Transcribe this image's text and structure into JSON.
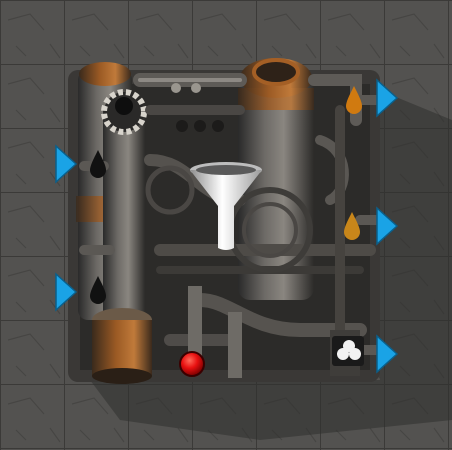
{
  "scene": {
    "entity": "oil-refinery",
    "ground": "concrete-tiles"
  },
  "recipe_icon": {
    "name": "filter-icon",
    "color": "#e8e8e8"
  },
  "ports": {
    "inputs": [
      {
        "name": "input-arrow-left-upper-icon",
        "fluid": "crude-oil",
        "color": "#1aa3e6"
      },
      {
        "name": "input-arrow-left-lower-icon",
        "fluid": "water",
        "color": "#1aa3e6"
      }
    ],
    "outputs": [
      {
        "name": "output-arrow-right-1-icon",
        "fluid": "petroleum-gas",
        "color": "#1aa3e6"
      },
      {
        "name": "output-arrow-right-2-icon",
        "fluid": "light-oil",
        "color": "#1aa3e6"
      },
      {
        "name": "output-arrow-right-3-icon",
        "fluid": "heavy-oil",
        "color": "#1aa3e6"
      }
    ]
  },
  "fluid_drop_icons": [
    {
      "name": "fluid-drop-orange-icon",
      "color": "#d07a10"
    },
    {
      "name": "fluid-drop-black-upper-icon",
      "color": "#111111"
    },
    {
      "name": "fluid-drop-amber-icon",
      "color": "#c8861a"
    },
    {
      "name": "fluid-drop-black-lower-icon",
      "color": "#111111"
    },
    {
      "name": "fluid-bubbles-icon",
      "color": "#f2f2f2"
    }
  ],
  "status_indicator": {
    "name": "status-light-red",
    "color": "#e81010"
  }
}
